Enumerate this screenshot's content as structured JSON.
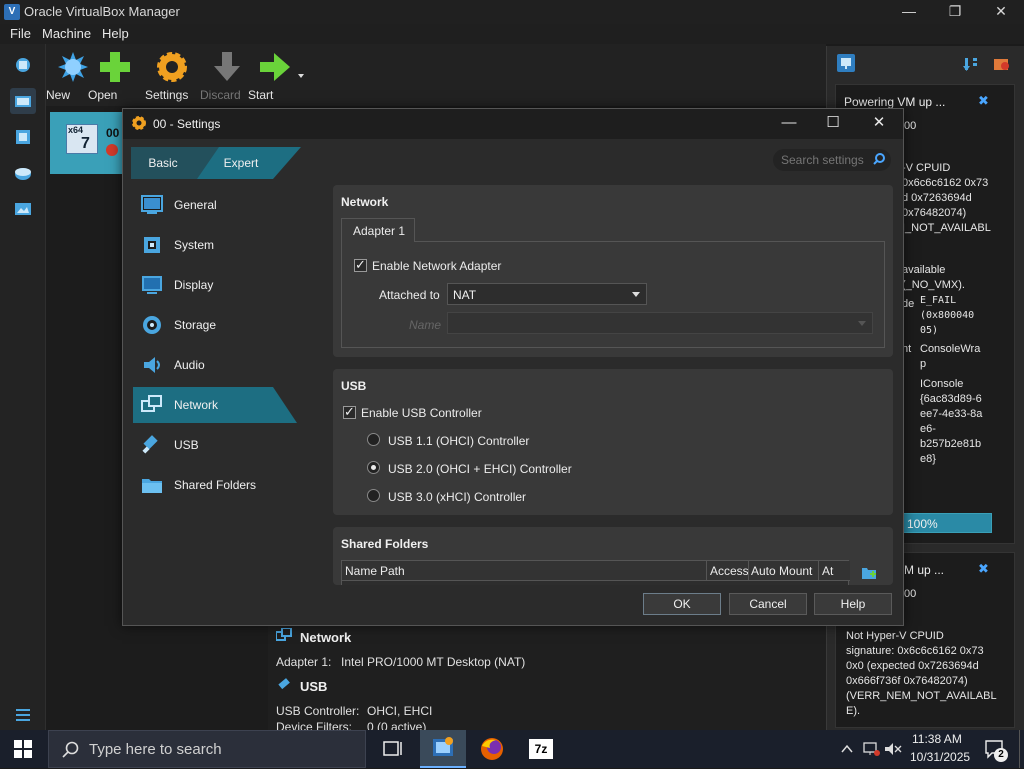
{
  "window": {
    "title": "Oracle VirtualBox Manager",
    "app_icon_glyph": "V"
  },
  "menu": [
    "File",
    "Machine",
    "Help"
  ],
  "toolbar": {
    "new": "New",
    "open": "Open",
    "settings": "Settings",
    "discard": "Discard",
    "start": "Start"
  },
  "vm": {
    "badge": "x64",
    "badge_num": "7",
    "name": "00"
  },
  "details": {
    "network_head": "Network",
    "adapter_label": "Adapter 1:",
    "adapter_value": "Intel PRO/1000 MT Desktop (NAT)",
    "usb_head": "USB",
    "usb_ctrl_label": "USB Controller:",
    "usb_ctrl_value": "OHCI, EHCI",
    "filters_label": "Device Filters:",
    "filters_value": "0 (0 active)"
  },
  "notifications": [
    {
      "title": "Powering VM up ...",
      "line_00": "00",
      "body": "-V CPUID\n0x6c6c6162 0x73\nd 0x7263694d\n0x76482074)\nI_NOT_AVAILABL",
      "extra": "available\n(_NO_VMX).",
      "code_label": "de",
      "code_value": "E_FAIL\n(0x800040\n05)",
      "comp_label": "nt",
      "comp_value": "ConsoleWra\np",
      "iface_value": "IConsole\n{6ac83d89-6\nee7-4e33-8a\ne6-\nb257b2e81b\ne8}",
      "progress": "100%"
    },
    {
      "title": "M up ...",
      "line_00": "00",
      "body": "Not Hyper-V CPUID\nsignature: 0x6c6c6162 0x73\n0x0 (expected 0x7263694d\n0x666f736f 0x76482074)\n(VERR_NEM_NOT_AVAILABL\nE)."
    }
  ],
  "dialog": {
    "title": "00 - Settings",
    "tabs": {
      "basic": "Basic",
      "expert": "Expert"
    },
    "search_placeholder": "Search settings",
    "categories": [
      "General",
      "System",
      "Display",
      "Storage",
      "Audio",
      "Network",
      "USB",
      "Shared Folders"
    ],
    "active_category": "Network",
    "network": {
      "title": "Network",
      "tab": "Adapter 1",
      "enable_label": "Enable Network Adapter",
      "attached_label": "Attached to",
      "attached_value": "NAT",
      "name_label": "Name"
    },
    "usb": {
      "title": "USB",
      "enable_label": "Enable USB Controller",
      "options": [
        "USB 1.1 (OHCI) Controller",
        "USB 2.0 (OHCI + EHCI) Controller",
        "USB 3.0 (xHCI) Controller"
      ],
      "selected": "USB 2.0 (OHCI + EHCI) Controller"
    },
    "shared": {
      "title": "Shared Folders",
      "columns": [
        "Name",
        "Path",
        "Access",
        "Auto Mount",
        "At"
      ]
    },
    "buttons": {
      "ok": "OK",
      "cancel": "Cancel",
      "help": "Help"
    }
  },
  "taskbar": {
    "search_placeholder": "Type here to search",
    "time": "11:38 AM",
    "date": "10/31/2025",
    "notif_count": "2",
    "zip_label": "7z"
  },
  "colors": {
    "accent": "#1d6e82",
    "vm_selected": "#3aa0b8",
    "progress": "#2a8aa6"
  }
}
